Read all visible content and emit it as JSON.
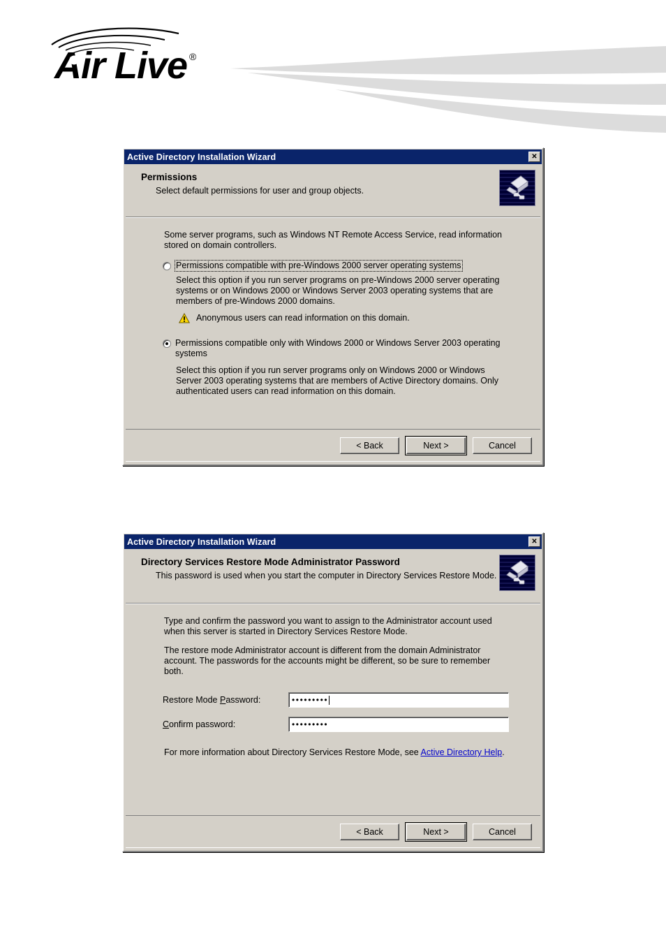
{
  "brand": {
    "logo_text": "Air Live",
    "logo_registered": "®",
    "logo_icon": "wireless-arcs-icon"
  },
  "dialogs": [
    {
      "titlebar": {
        "title": "Active Directory Installation Wizard",
        "close_label": "✕",
        "close_icon": "close-icon",
        "bg_color": "#0a246a"
      },
      "header": {
        "title": "Permissions",
        "subtitle": "Select default permissions for user and group objects.",
        "icon": "active-directory-wizard-icon"
      },
      "body": {
        "intro": "Some server programs, such as Windows NT Remote Access Service, read information stored on domain controllers.",
        "option1": {
          "label": "Permissions compatible with pre-Windows 2000 server operating systems",
          "selected": false,
          "focused": true,
          "description": "Select this option if you run server programs on pre-Windows 2000 server operating systems or on Windows 2000 or Windows Server 2003 operating systems that are members of pre-Windows 2000 domains.",
          "warning_icon": "warning-triangle-icon",
          "warning_text": "Anonymous users can read information on this domain."
        },
        "option2": {
          "label": "Permissions compatible only with Windows 2000 or Windows Server 2003 operating systems",
          "selected": true,
          "focused": false,
          "description": "Select this option if you run server programs only on Windows 2000 or Windows Server 2003 operating systems that are members of Active Directory domains. Only authenticated users can read information on this domain."
        }
      },
      "buttons": {
        "back": "< Back",
        "next": "Next >",
        "cancel": "Cancel",
        "default": "next"
      }
    },
    {
      "titlebar": {
        "title": "Active Directory Installation Wizard",
        "close_label": "✕",
        "close_icon": "close-icon",
        "bg_color": "#0a246a"
      },
      "header": {
        "title": "Directory Services Restore Mode Administrator Password",
        "subtitle": "This password is used when you start the computer in Directory Services Restore Mode.",
        "icon": "active-directory-wizard-icon"
      },
      "body": {
        "para1": "Type and confirm the password you want to assign to the Administrator account used when this server is started in Directory Services Restore Mode.",
        "para2": "The restore mode Administrator account is different from the domain Administrator account. The passwords for the accounts might be different, so be sure to remember both.",
        "fields": [
          {
            "label": "Restore Mode Password:",
            "value": "•••••••••",
            "focused": true
          },
          {
            "label": "Confirm password:",
            "value": "•••••••••",
            "focused": false
          }
        ],
        "footer_prefix": "For more information about Directory Services Restore Mode, see ",
        "footer_link": "Active Directory Help",
        "footer_suffix": "."
      },
      "buttons": {
        "back": "< Back",
        "next": "Next >",
        "cancel": "Cancel",
        "default": "next"
      }
    }
  ],
  "colors": {
    "titlebar": "#0a246a",
    "dialog_face": "#d4d0c8",
    "link": "#0000cd",
    "warning": "#ffd900",
    "swoosh": "#dcdcdc"
  }
}
